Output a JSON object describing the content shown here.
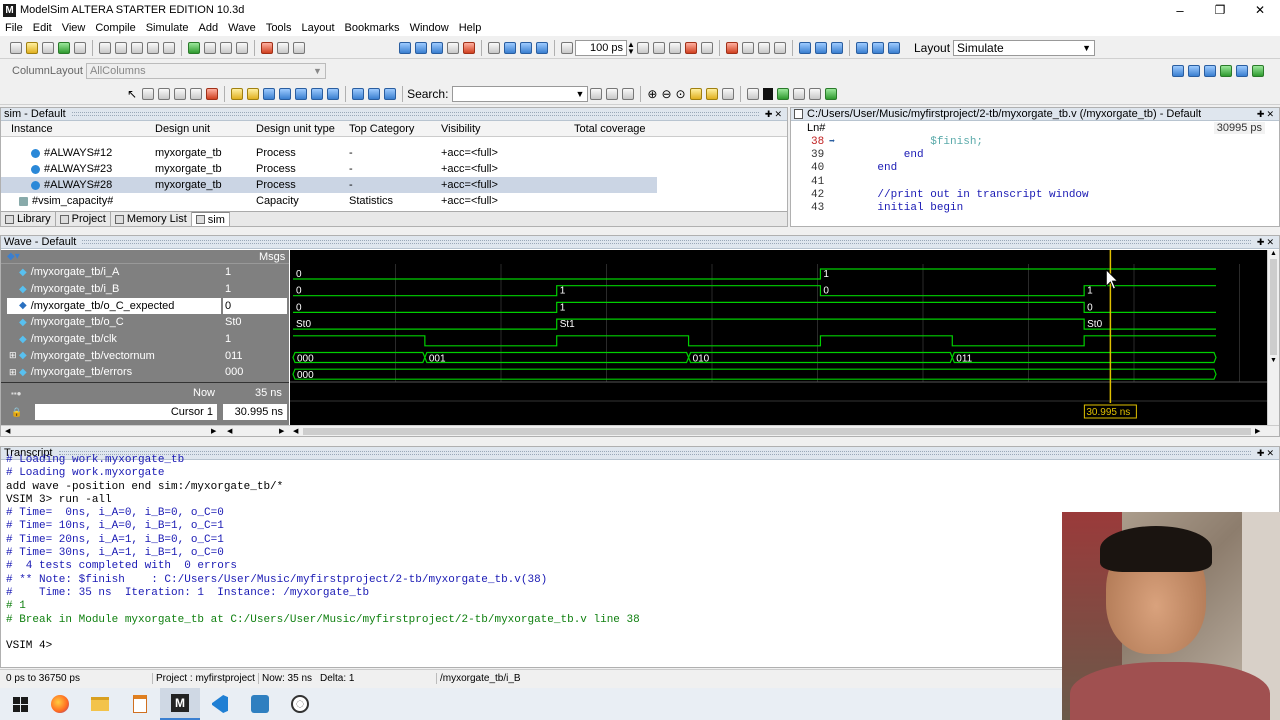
{
  "window": {
    "title": "ModelSim ALTERA STARTER EDITION 10.3d",
    "controls": [
      "–",
      "❐",
      "✕"
    ]
  },
  "menu": [
    "File",
    "Edit",
    "View",
    "Compile",
    "Simulate",
    "Add",
    "Wave",
    "Tools",
    "Layout",
    "Bookmarks",
    "Window",
    "Help"
  ],
  "toolbar": {
    "run_length": "100 ps",
    "layout_label": "Layout",
    "layout_value": "Simulate",
    "column_layout_label": "ColumnLayout",
    "column_layout_value": "AllColumns",
    "search_label": "Search:"
  },
  "sim_panel": {
    "title": "sim - Default",
    "columns": [
      "Instance",
      "Design unit",
      "Design unit type",
      "Top Category",
      "Visibility",
      "Total coverage"
    ],
    "rows": [
      {
        "instance": "#ALWAYS#12",
        "unit": "myxorgate_tb",
        "type": "Process",
        "top": "-",
        "vis": "+acc=<full>",
        "cov": ""
      },
      {
        "instance": "#ALWAYS#23",
        "unit": "myxorgate_tb",
        "type": "Process",
        "top": "-",
        "vis": "+acc=<full>",
        "cov": ""
      },
      {
        "instance": "#ALWAYS#28",
        "unit": "myxorgate_tb",
        "type": "Process",
        "top": "-",
        "vis": "+acc=<full>",
        "cov": ""
      },
      {
        "instance": "#vsim_capacity#",
        "unit": "",
        "type": "Capacity",
        "top": "Statistics",
        "vis": "+acc=<full>",
        "cov": ""
      }
    ],
    "tabs": [
      "Library",
      "Project",
      "Memory List",
      "sim"
    ]
  },
  "source_panel": {
    "title": "C:/Users/User/Music/myfirstproject/2-tb/myxorgate_tb.v (/myxorgate_tb) - Default",
    "ln_header": "Ln#",
    "time": "30995 ps",
    "lines": [
      {
        "n": "38",
        "code": "            $finish;"
      },
      {
        "n": "39",
        "code": "        end"
      },
      {
        "n": "40",
        "code": "    end"
      },
      {
        "n": "41",
        "code": ""
      },
      {
        "n": "42",
        "code": "    //print out in transcript window"
      },
      {
        "n": "43",
        "code": "    initial begin"
      }
    ]
  },
  "wave_panel": {
    "title": "Wave - Default",
    "msgs_label": "Msgs",
    "signals": [
      {
        "name": "/myxorgate_tb/i_A",
        "value": "1",
        "sel": true,
        "expand": false
      },
      {
        "name": "/myxorgate_tb/i_B",
        "value": "1",
        "sel": true,
        "expand": false
      },
      {
        "name": "/myxorgate_tb/o_C_expected",
        "value": "0",
        "sel": false,
        "expand": false
      },
      {
        "name": "/myxorgate_tb/o_C",
        "value": "St0",
        "sel": true,
        "expand": false
      },
      {
        "name": "/myxorgate_tb/clk",
        "value": "1",
        "sel": true,
        "expand": false
      },
      {
        "name": "/myxorgate_tb/vectornum",
        "value": "011",
        "sel": true,
        "expand": true
      },
      {
        "name": "/myxorgate_tb/errors",
        "value": "000",
        "sel": true,
        "expand": true
      }
    ],
    "now_label": "Now",
    "now_value": "35 ns",
    "cursor_label": "Cursor 1",
    "cursor_value": "30.995 ns",
    "cursor_flag": "30.995 ns",
    "wave_labels": {
      "i_A": [
        "0",
        "1"
      ],
      "i_B": [
        "0",
        "1",
        "0",
        "1"
      ],
      "o_C_expected": [
        "0",
        "1",
        "0"
      ],
      "o_C": [
        "St0",
        "St1",
        "St0"
      ],
      "vectornum": [
        "000",
        "001",
        "010",
        "011"
      ],
      "errors": [
        "000"
      ]
    }
  },
  "transcript": {
    "title": "Transcript",
    "lines": [
      {
        "c": "blue",
        "t": "# Loading work.myxorgate_tb"
      },
      {
        "c": "blue",
        "t": "# Loading work.myxorgate"
      },
      {
        "c": "blk",
        "t": "add wave -position end sim:/myxorgate_tb/*"
      },
      {
        "c": "blk",
        "t": "VSIM 3> run -all"
      },
      {
        "c": "blue",
        "t": "# Time=  0ns, i_A=0, i_B=0, o_C=0"
      },
      {
        "c": "blue",
        "t": "# Time= 10ns, i_A=0, i_B=1, o_C=1"
      },
      {
        "c": "blue",
        "t": "# Time= 20ns, i_A=1, i_B=0, o_C=1"
      },
      {
        "c": "blue",
        "t": "# Time= 30ns, i_A=1, i_B=1, o_C=0"
      },
      {
        "c": "blue",
        "t": "#  4 tests completed with  0 errors"
      },
      {
        "c": "blue",
        "t": "# ** Note: $finish    : C:/Users/User/Music/myfirstproject/2-tb/myxorgate_tb.v(38)"
      },
      {
        "c": "blue",
        "t": "#    Time: 35 ns  Iteration: 1  Instance: /myxorgate_tb"
      },
      {
        "c": "grn",
        "t": "# 1"
      },
      {
        "c": "grn",
        "t": "# Break in Module myxorgate_tb at C:/Users/User/Music/myfirstproject/2-tb/myxorgate_tb.v line 38"
      },
      {
        "c": "blk",
        "t": ""
      },
      {
        "c": "blk",
        "t": "VSIM 4>"
      }
    ]
  },
  "status": {
    "range": "0 ps to 36750 ps",
    "project": "Project : myfirstproject",
    "now": "Now: 35 ns",
    "delta": "Delta: 1",
    "selected": "/myxorgate_tb/i_B"
  },
  "colors": {
    "wave_bg": "#000000",
    "wave_green": "#00d000",
    "cursor": "#e0c000",
    "signal_panel": "#808080"
  },
  "taskbar_icons": [
    "windows-icon",
    "firefox-icon",
    "file-explorer-icon",
    "notepad-icon",
    "modelsim-icon",
    "vscode-icon",
    "network-icon",
    "chrome-icon"
  ]
}
